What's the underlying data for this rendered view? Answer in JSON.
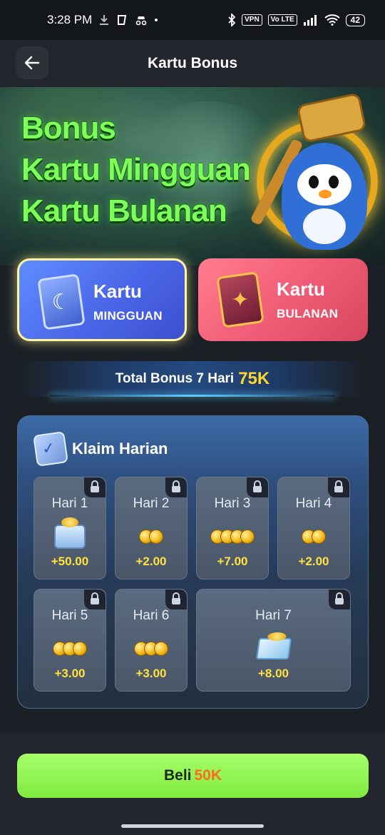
{
  "status_bar": {
    "time": "3:28 PM",
    "vpn": "VPN",
    "volte": "Vo LTE",
    "battery": "42",
    "icons": [
      "download-icon",
      "shield-app-icon",
      "incognito-icon",
      "bluetooth-icon",
      "signal-icon",
      "wifi-icon",
      "battery-icon"
    ]
  },
  "header": {
    "title": "Kartu Bonus",
    "back_icon": "arrow-left-icon"
  },
  "banner": {
    "line1": "Bonus",
    "line2": "Kartu Mingguan",
    "line3": "Kartu Bulanan"
  },
  "tabs": [
    {
      "title": "Kartu",
      "subtitle": "MINGGUAN",
      "selected": true,
      "icon": "weekly-card-icon"
    },
    {
      "title": "Kartu",
      "subtitle": "BULANAN",
      "selected": false,
      "icon": "monthly-card-icon"
    }
  ],
  "total_bonus": {
    "label": "Total Bonus 7 Hari",
    "value": "75K"
  },
  "claim": {
    "title": "Klaim Harian",
    "days": [
      {
        "label": "Hari 1",
        "amount": "+50.00",
        "reward": "chest",
        "locked": true
      },
      {
        "label": "Hari 2",
        "amount": "+2.00",
        "reward": "coins",
        "locked": true
      },
      {
        "label": "Hari 3",
        "amount": "+7.00",
        "reward": "coins",
        "locked": true
      },
      {
        "label": "Hari 4",
        "amount": "+2.00",
        "reward": "coins",
        "locked": true
      },
      {
        "label": "Hari 5",
        "amount": "+3.00",
        "reward": "coins",
        "locked": true
      },
      {
        "label": "Hari 6",
        "amount": "+3.00",
        "reward": "coins",
        "locked": true
      },
      {
        "label": "Hari 7",
        "amount": "+8.00",
        "reward": "crate",
        "locked": true
      }
    ]
  },
  "buy": {
    "label": "Beli",
    "price": "50K"
  },
  "colors": {
    "accent_green": "#7fea3f",
    "gold": "#ffd62e",
    "price_orange": "#ff6b1a",
    "weekly_blue": "#4a66e8",
    "monthly_pink": "#ef5a74"
  }
}
